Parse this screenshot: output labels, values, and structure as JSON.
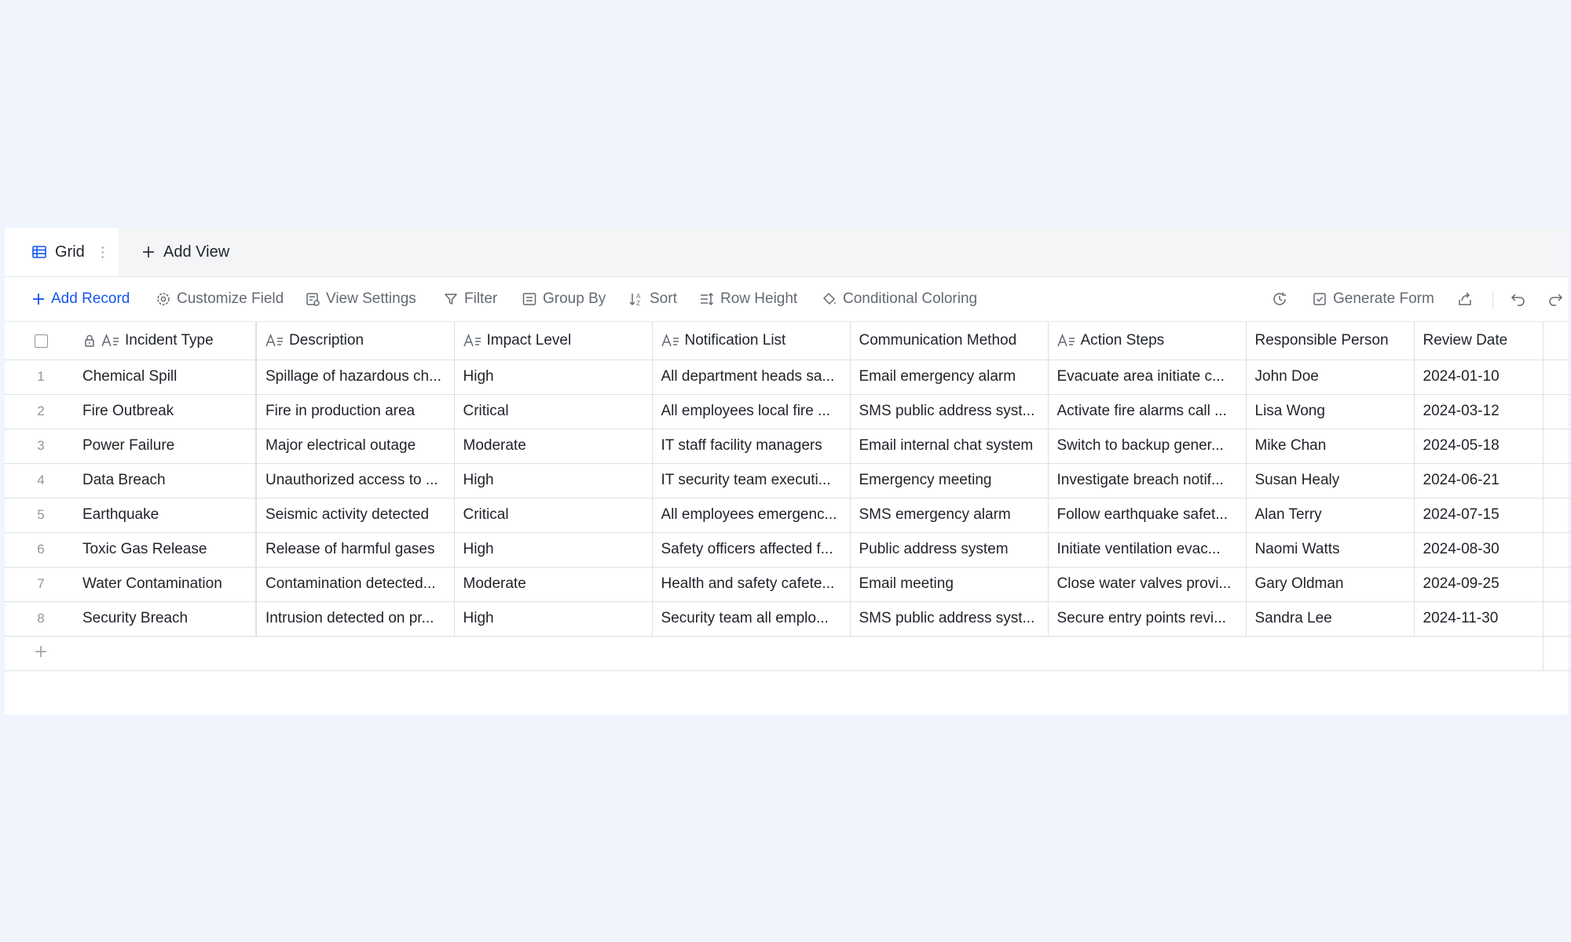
{
  "tabs": {
    "active": "Grid",
    "add_view": "Add View"
  },
  "toolbar": {
    "add_record": "Add Record",
    "customize_field": "Customize Field",
    "view_settings": "View Settings",
    "filter": "Filter",
    "group_by": "Group By",
    "sort": "Sort",
    "row_height": "Row Height",
    "conditional_coloring": "Conditional Coloring",
    "generate_form": "Generate Form"
  },
  "columns": [
    "Incident Type",
    "Description",
    "Impact Level",
    "Notification List",
    "Communication Method",
    "Action Steps",
    "Responsible Person",
    "Review Date"
  ],
  "rows": [
    {
      "n": "1",
      "cells": [
        "Chemical Spill",
        "Spillage of hazardous ch...",
        "High",
        "All department heads sa...",
        "Email emergency alarm",
        "Evacuate area initiate c...",
        "John Doe",
        "2024-01-10"
      ]
    },
    {
      "n": "2",
      "cells": [
        "Fire Outbreak",
        "Fire in production area",
        "Critical",
        "All employees local fire ...",
        "SMS public address syst...",
        "Activate fire alarms call ...",
        "Lisa Wong",
        "2024-03-12"
      ]
    },
    {
      "n": "3",
      "cells": [
        "Power Failure",
        "Major electrical outage",
        "Moderate",
        "IT staff facility managers",
        "Email internal chat system",
        "Switch to backup gener...",
        "Mike Chan",
        "2024-05-18"
      ]
    },
    {
      "n": "4",
      "cells": [
        "Data Breach",
        "Unauthorized access to ...",
        "High",
        "IT security team executi...",
        "Emergency meeting",
        "Investigate breach notif...",
        "Susan Healy",
        "2024-06-21"
      ]
    },
    {
      "n": "5",
      "cells": [
        "Earthquake",
        "Seismic activity detected",
        "Critical",
        "All employees emergenc...",
        "SMS emergency alarm",
        "Follow earthquake safet...",
        "Alan Terry",
        "2024-07-15"
      ]
    },
    {
      "n": "6",
      "cells": [
        "Toxic Gas Release",
        "Release of harmful gases",
        "High",
        "Safety officers affected f...",
        "Public address system",
        "Initiate ventilation evac...",
        "Naomi Watts",
        "2024-08-30"
      ]
    },
    {
      "n": "7",
      "cells": [
        "Water Contamination",
        "Contamination detected...",
        "Moderate",
        "Health and safety cafete...",
        "Email meeting",
        "Close water valves provi...",
        "Gary Oldman",
        "2024-09-25"
      ]
    },
    {
      "n": "8",
      "cells": [
        "Security Breach",
        "Intrusion detected on pr...",
        "High",
        "Security team all emplo...",
        "SMS public address syst...",
        "Secure entry points revi...",
        "Sandra Lee",
        "2024-11-30"
      ]
    }
  ],
  "colors": {
    "accent": "#1456f0",
    "background": "#eff4fd",
    "border": "#dee0e3",
    "muted_text": "#646a73"
  }
}
